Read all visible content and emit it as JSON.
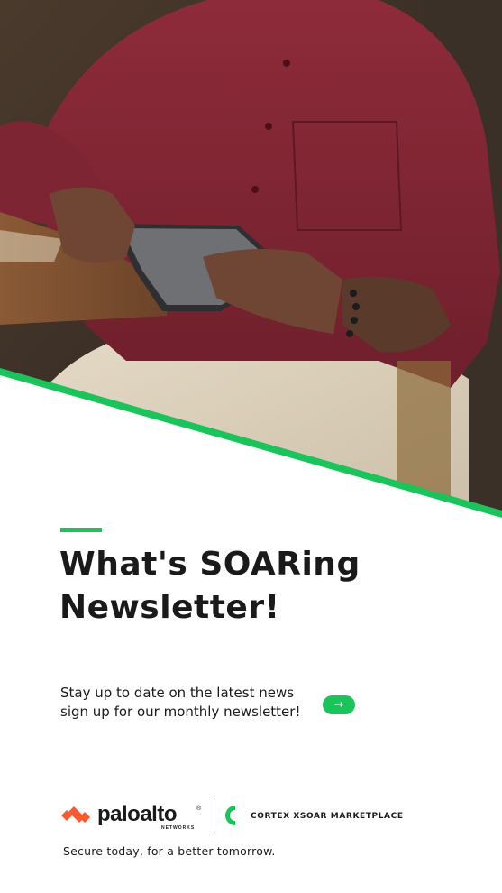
{
  "hero": {
    "image": "man-in-red-shirt-holding-tablet-photo",
    "accent_color": "#1bc45a"
  },
  "headline": {
    "line1": "What's SOARing",
    "line2": "Newsletter!"
  },
  "body": {
    "line1": "Stay up to date on the latest news",
    "line2": "sign up for our monthly newsletter!"
  },
  "cta": {
    "icon": "arrow-right-icon",
    "glyph": "→",
    "color": "#1bc45a"
  },
  "footer": {
    "brand_name": "paloalto",
    "brand_registered": "®",
    "brand_sub": "NETWORKS",
    "product": "CORTEX XSOAR MARKETPLACE",
    "tagline": "Secure today, for a better tomorrow."
  },
  "colors": {
    "brand_green": "#1bc45a",
    "brand_orange": "#fa582d",
    "text": "#1a1a1a"
  }
}
